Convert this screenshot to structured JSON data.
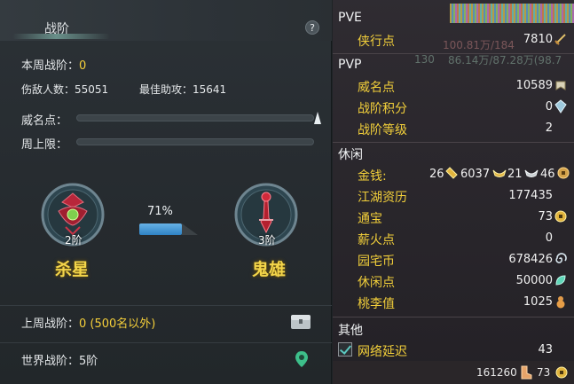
{
  "left": {
    "title": "战阶",
    "help_label": "?",
    "week_rank_label": "本周战阶：",
    "week_rank_value": "0",
    "damage_people": "伤敌人数：55051",
    "best_assist": "最佳助攻：15641",
    "fame_label": "威名点：",
    "week_limit_label": "周上限：",
    "progress_percent": "71%",
    "progress_fraction": 0.71,
    "current_tier": {
      "level": "2阶",
      "name": "杀星"
    },
    "next_tier": {
      "level": "3阶",
      "name": "鬼雄"
    },
    "last_week_label": "上周战阶：",
    "last_week_value": "0 (500名以外)",
    "world_label": "世界战阶：5阶"
  },
  "right": {
    "bg_text_1": "100.81万/184",
    "bg_text_2": "86.14万/87.28万(98.7",
    "bg_num": "130",
    "pve": {
      "header": "PVE",
      "items": [
        {
          "label": "侠行点",
          "value": "7810",
          "icon": "sword-icon"
        }
      ]
    },
    "pvp": {
      "header": "PVP",
      "items": [
        {
          "label": "威名点",
          "value": "10589",
          "icon": "fame-icon"
        },
        {
          "label": "战阶积分",
          "value": "0",
          "icon": "crystal-icon"
        },
        {
          "label": "战阶等级",
          "value": "2"
        }
      ]
    },
    "leisure": {
      "header": "休闲",
      "money_label": "金钱:",
      "money_gold": "26",
      "money_silver": "6037",
      "money_bronze": "21",
      "money_copper": "46",
      "items": [
        {
          "label": "江湖资历",
          "value": "177435"
        },
        {
          "label": "通宝",
          "value": "73",
          "icon": "coin-icon"
        },
        {
          "label": "薪火点",
          "value": "0"
        },
        {
          "label": "园宅币",
          "value": "678426",
          "icon": "swirl-icon"
        },
        {
          "label": "休闲点",
          "value": "50000",
          "icon": "leaf-icon"
        },
        {
          "label": "桃李值",
          "value": "1025",
          "icon": "gourd-icon"
        }
      ]
    },
    "other": {
      "header": "其他",
      "latency_label": "网络延迟",
      "latency_value": "43"
    },
    "footer": {
      "value1": "161260",
      "value2": "73"
    }
  },
  "colors": {
    "accent_yellow": "#f5cf3a",
    "progress_blue": "#3d8fd0"
  }
}
